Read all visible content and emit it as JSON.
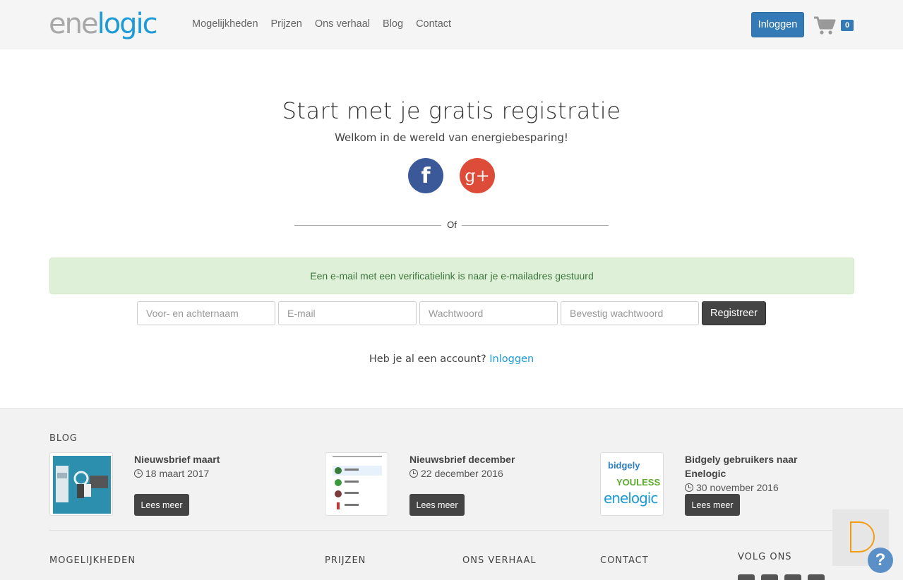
{
  "header": {
    "logo_part1": "ene",
    "logo_part2": "logic",
    "nav": [
      "Mogelijkheden",
      "Prijzen",
      "Ons verhaal",
      "Blog",
      "Contact"
    ],
    "login_label": "Inloggen",
    "cart_count": "0"
  },
  "main": {
    "title": "Start met je gratis registratie",
    "subtitle": "Welkom in de wereld van energiebesparing!",
    "facebook_glyph": "f",
    "google_glyph": "g+",
    "or_label": "Of",
    "alert": "Een e-mail met een verificatielink is naar je e-mailadres gestuurd",
    "form": {
      "name_placeholder": "Voor- en achternaam",
      "email_placeholder": "E-mail",
      "password_placeholder": "Wachtwoord",
      "confirm_placeholder": "Bevestig wachtwoord",
      "submit_label": "Registreer"
    },
    "have_account_text": "Heb je al een account?",
    "have_account_link": "Inloggen"
  },
  "footer": {
    "blog_heading": "BLOG",
    "posts": [
      {
        "title": "Nieuwsbrief maart",
        "date": "18 maart 2017",
        "button": "Lees meer"
      },
      {
        "title": "Nieuwsbrief december",
        "date": "22 december 2016",
        "button": "Lees meer"
      },
      {
        "title": "Bidgely gebruikers naar Enelogic",
        "date": "30 november 2016",
        "button": "Lees meer",
        "logos": [
          "bidgely",
          "YOULESS",
          "enelogic"
        ]
      }
    ],
    "columns": [
      "MOGELIJKHEDEN",
      "PRIJZEN",
      "ONS VERHAAL",
      "CONTACT",
      "VOLG ONS"
    ],
    "widget_letter": "D",
    "help_glyph": "?"
  },
  "colors": {
    "brand_blue": "#1e9ad6",
    "button_blue": "#337ab7",
    "facebook": "#3b5998",
    "google": "#dd4b39",
    "alert_bg": "#dff0d8",
    "alert_text": "#3c763d",
    "dark_button": "#444444"
  }
}
